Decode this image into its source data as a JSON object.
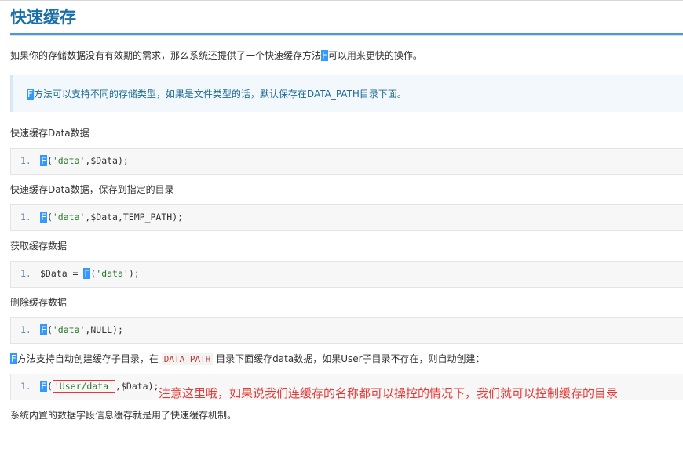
{
  "page": {
    "title": "快速缓存"
  },
  "intro": {
    "before": "如果你的存储数据没有有效期的需求，那么系统还提供了一个快速缓存方法",
    "highlight": "F",
    "after": "可以用来更快的操作。"
  },
  "note": {
    "highlight": "F",
    "text": "方法可以支持不同的存储类型，如果是文件类型的话，默认保存在DATA_PATH目录下面。"
  },
  "sections": [
    {
      "heading": "快速缓存Data数据",
      "line_no": "1.",
      "fn": "F",
      "pre": "(",
      "str": "'data'",
      "post": ",$Data);"
    },
    {
      "heading": "快速缓存Data数据，保存到指定的目录",
      "line_no": "1.",
      "fn": "F",
      "pre": "(",
      "str": "'data'",
      "post": ",$Data,TEMP_PATH);"
    },
    {
      "heading": "获取缓存数据",
      "line_no": "1.",
      "prefix": "$Data = ",
      "fn": "F",
      "pre": "(",
      "str": "'data'",
      "post": ");"
    },
    {
      "heading": "删除缓存数据",
      "line_no": "1.",
      "fn": "F",
      "pre": "(",
      "str": "'data'",
      "post": ",NULL);"
    }
  ],
  "subdir": {
    "highlight": "F",
    "text1": "方法支持自动创建缓存子目录，在 ",
    "code": "DATA_PATH",
    "text2": " 目录下面缓存data数据，如果User子目录不存在，则自动创建：",
    "line_no": "1.",
    "fn": "F",
    "pre": "(",
    "str": "'User/data'",
    "post": ",$Data);"
  },
  "annotation": "注意这里哦，如果说我们连缓存的名称都可以操控的情况下，我们就可以控制缓存的目录",
  "footer": "系统内置的数据字段信息缓存就是用了快速缓存机制。",
  "colors": {
    "title": "#1a6fa8",
    "highlight": "#3399ff",
    "annotation": "#e53935",
    "string": "#2a7a2a"
  }
}
